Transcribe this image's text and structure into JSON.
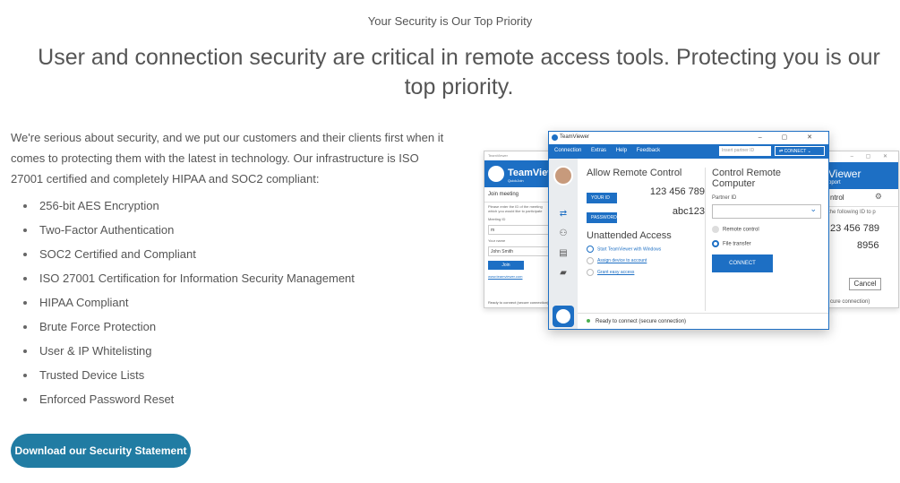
{
  "header": {
    "eyebrow": "Your Security is Our Top Priority",
    "headline": "User and connection security are critical in remote access tools. Protecting you is our top priority."
  },
  "intro": "We're serious about security, and we put our customers and their clients first when it comes to protecting them with the latest in technology. Our infrastructure is ISO 27001 certified and completely HIPAA and SOC2 compliant:",
  "features": [
    "256-bit AES Encryption",
    "Two-Factor Authentication",
    "SOC2 Certified and Compliant",
    "ISO 27001 Certification for Information Security Management",
    "HIPAA Compliant",
    "Brute Force Protection",
    "User & IP Whitelisting",
    "Trusted Device Lists",
    "Enforced Password Reset"
  ],
  "cta": {
    "label": "Download our Security Statement"
  },
  "colors": {
    "accent": "#217ca3",
    "tv_blue": "#1d6fc4",
    "status_green": "#4caf50"
  },
  "screenshot": {
    "left_window": {
      "title": "TeamViewer",
      "brand": "TeamViewer",
      "brand_sub": "QuickJoin",
      "section": "Join meeting",
      "instructions": "Please enter the ID of the meeting which you would like to participate",
      "meeting_id_label": "Meeting ID",
      "meeting_id_value": "m",
      "name_label": "Your name",
      "name_value": "John Smith",
      "join_label": "Join",
      "link": "www.teamviewer.com",
      "status": "Ready to connect (secure connection)"
    },
    "right_window": {
      "brand": "Viewer",
      "brand_sub": "pport",
      "section": "ntrol",
      "instructions": "the following ID to p",
      "id_value": "23 456 789",
      "pw_value": "8956",
      "cancel_label": "Cancel",
      "status": "cure connection)"
    },
    "main_window": {
      "title": "TeamViewer",
      "menu": [
        "Connection",
        "Extras",
        "Help",
        "Feedback"
      ],
      "partner_id_placeholder": "Insert partner ID",
      "connect_small": "CONNECT",
      "allow_title": "Allow Remote Control",
      "your_id_label": "YOUR ID",
      "your_id_value": "123 456 789",
      "password_label": "PASSWORD",
      "password_value": "abc123",
      "unattended_title": "Unattended Access",
      "unattended_items": [
        "Start TeamViewer with Windows",
        "Assign device to account",
        "Grant easy access"
      ],
      "control_title": "Control Remote Computer",
      "partner_id_label": "Partner ID",
      "radio_remote": "Remote control",
      "radio_file": "File transfer",
      "connect_label": "CONNECT",
      "status": "Ready to connect (secure connection)"
    }
  }
}
